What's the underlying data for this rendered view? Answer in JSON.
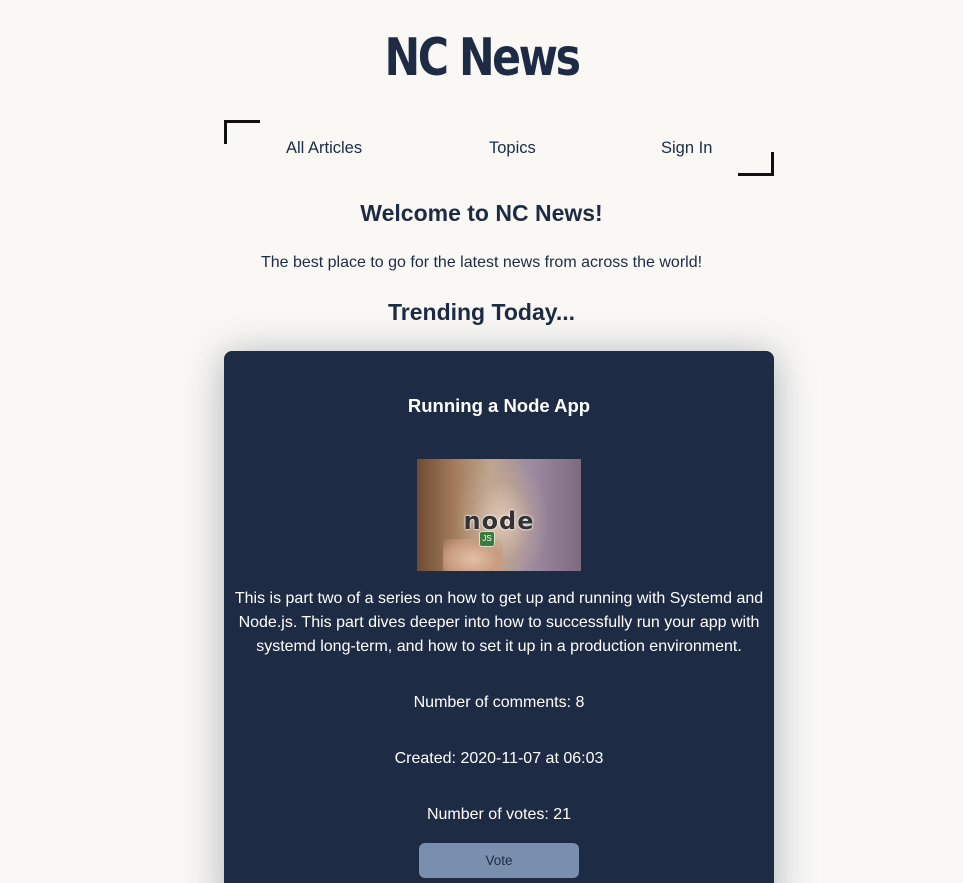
{
  "header": {
    "site_title": "NC News"
  },
  "nav": {
    "items": [
      {
        "label": "All Articles"
      },
      {
        "label": "Topics"
      },
      {
        "label": "Sign In"
      }
    ]
  },
  "home": {
    "welcome": "Welcome to NC News!",
    "tagline": "The best place to go for the latest news from across the world!",
    "trending_heading": "Trending Today..."
  },
  "article": {
    "title": "Running a Node App",
    "image_logo_text": "node",
    "image_logo_sub": "JS",
    "body": "This is part two of a series on how to get up and running with Systemd and Node.js. This part dives deeper into how to successfully run your app with systemd long-term, and how to set it up in a production environment.",
    "comments": "Number of comments: 8",
    "created": "Created: 2020-11-07 at 06:03",
    "votes": "Number of votes: 21",
    "vote_button": "Vote"
  },
  "colors": {
    "background": "#f9f8f5",
    "navy": "#1e2b44",
    "vote_button": "#7a8fad",
    "card_text": "#ffffff"
  }
}
